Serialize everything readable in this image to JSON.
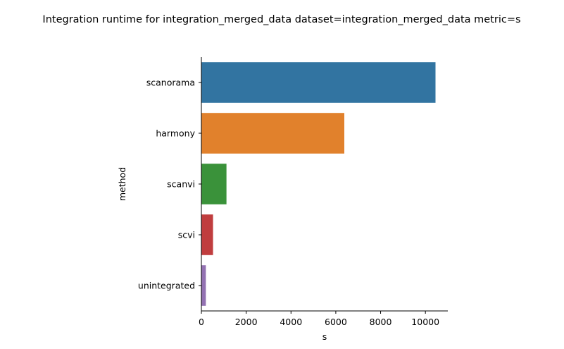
{
  "chart_data": {
    "type": "bar",
    "orientation": "horizontal",
    "title": "Integration runtime for integration_merged_data dataset=integration_merged_data metric=s",
    "xlabel": "s",
    "ylabel": "method",
    "categories": [
      "scanorama",
      "harmony",
      "scanvi",
      "scvi",
      "unintegrated"
    ],
    "values": [
      10450,
      6380,
      1120,
      520,
      200
    ],
    "colors": [
      "#3274a1",
      "#e1812c",
      "#3a923a",
      "#c03d3e",
      "#9372b2"
    ],
    "xlim": [
      0,
      11000
    ],
    "xticks": [
      0,
      2000,
      4000,
      6000,
      8000,
      10000
    ],
    "xtick_labels": [
      "0",
      "2000",
      "4000",
      "6000",
      "8000",
      "10000"
    ],
    "grid": false,
    "legend": "none"
  }
}
